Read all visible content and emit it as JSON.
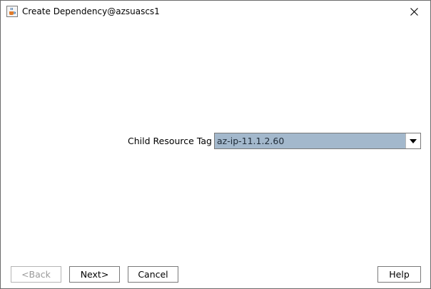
{
  "window": {
    "title": "Create Dependency@azsuascs1",
    "app_icon": "java-coffee-icon",
    "close_icon": "close-icon"
  },
  "form": {
    "child_resource_tag_label": "Child Resource Tag",
    "child_resource_tag_value": "az-ip-11.1.2.60",
    "dropdown_icon": "chevron-down-icon"
  },
  "buttons": {
    "back": "<Back",
    "next": "Next>",
    "cancel": "Cancel",
    "help": "Help"
  },
  "colors": {
    "combo_selected_bg": "#a3b8cc",
    "disabled_text": "#9a9a9a"
  }
}
